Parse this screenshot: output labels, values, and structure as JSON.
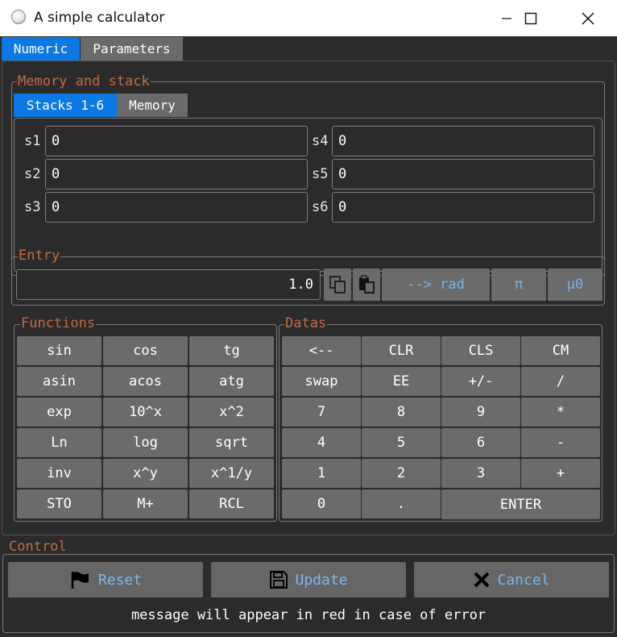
{
  "window": {
    "title": "A simple calculator"
  },
  "main_tabs": [
    "Numeric",
    "Parameters"
  ],
  "memory_group": {
    "title": "Memory and stack",
    "tabs": [
      "Stacks 1-6",
      "Memory"
    ],
    "stacks": [
      {
        "label": "s1",
        "value": "0"
      },
      {
        "label": "s2",
        "value": "0"
      },
      {
        "label": "s3",
        "value": "0"
      },
      {
        "label": "s4",
        "value": "0"
      },
      {
        "label": "s5",
        "value": "0"
      },
      {
        "label": "s6",
        "value": "0"
      }
    ]
  },
  "entry": {
    "title": "Entry",
    "value": "1.0",
    "convert_label": "--> rad",
    "pi_label": "π",
    "mu0_label": "µ0"
  },
  "functions": {
    "title": "Functions",
    "buttons": [
      "sin",
      "cos",
      "tg",
      "asin",
      "acos",
      "atg",
      "exp",
      "10^x",
      "x^2",
      "Ln",
      "log",
      "sqrt",
      "inv",
      "x^y",
      "x^1/y",
      "STO",
      "M+",
      "RCL"
    ]
  },
  "datas": {
    "title": "Datas",
    "buttons": [
      "<--",
      "CLR",
      "CLS",
      "CM",
      "swap",
      "EE",
      "+/-",
      "/",
      "7",
      "8",
      "9",
      "*",
      "4",
      "5",
      "6",
      "-",
      "1",
      "2",
      "3",
      "+",
      "0",
      "."
    ],
    "enter_label": "ENTER"
  },
  "control": {
    "title": "Control",
    "reset_label": "Reset",
    "update_label": "Update",
    "cancel_label": "Cancel",
    "message": "message will appear in red in case of error"
  }
}
